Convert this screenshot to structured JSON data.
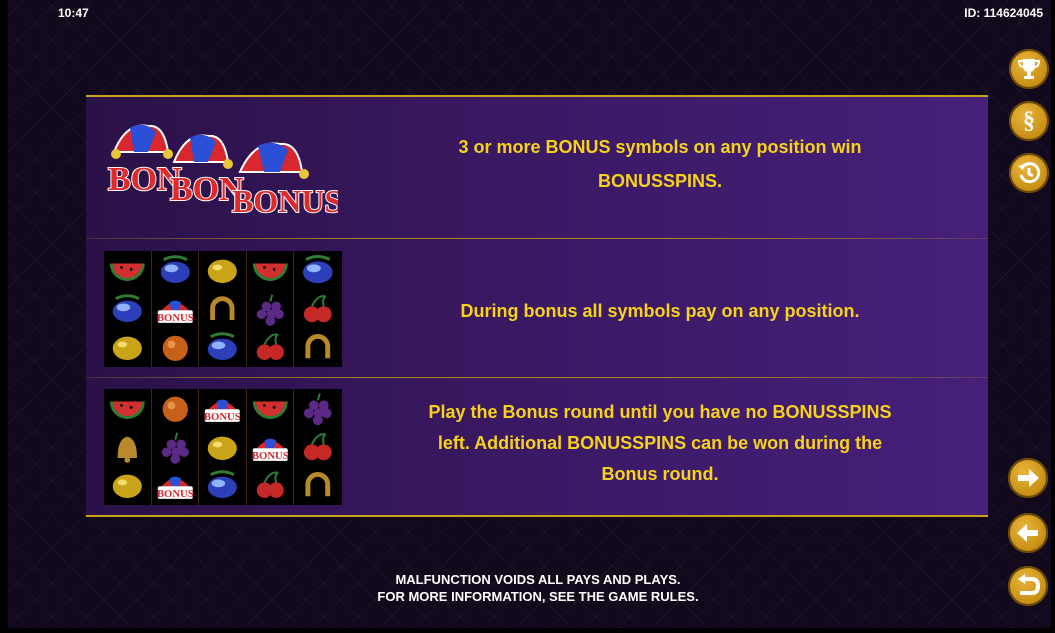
{
  "status": {
    "time": "10:47",
    "id_label": "ID: 114624045"
  },
  "rows": [
    {
      "text_lines": [
        "3 or more BONUS symbols on any position win",
        "BONUSSPINS."
      ]
    },
    {
      "text_lines": [
        "During bonus all symbols pay on any position."
      ]
    },
    {
      "text_lines": [
        "Play the Bonus round until you have no BONUSSPINS",
        "left. Additional BONUSSPINS can be won during the",
        "Bonus round."
      ]
    }
  ],
  "logo": {
    "words": [
      "BON",
      "BON",
      "BONUS"
    ]
  },
  "grid_symbol_label": "BONUS",
  "grid2": [
    "watermelon",
    "plum",
    "lemon",
    "watermelon",
    "plum",
    "plum",
    "bonus",
    "horseshoe",
    "grapes",
    "cherry",
    "lemon",
    "orange",
    "plum",
    "cherry",
    "horseshoe"
  ],
  "grid3": [
    "watermelon",
    "orange",
    "bonus",
    "watermelon",
    "grapes",
    "bell",
    "grapes",
    "lemon",
    "bonus",
    "cherry",
    "lemon",
    "bonus",
    "plum",
    "cherry",
    "horseshoe"
  ],
  "side_buttons": {
    "right_top": [
      "trophy-icon",
      "section-sign-icon",
      "history-icon"
    ],
    "right_bottom": [
      "arrow-right-icon",
      "arrow-left-icon",
      "return-icon"
    ]
  },
  "section_glyph": "§",
  "footer": {
    "line1": "MALFUNCTION VOIDS ALL PAYS AND PLAYS.",
    "line2": "FOR MORE INFORMATION, SEE THE GAME RULES."
  },
  "colors": {
    "accent_text": "#f6d21a",
    "gold_line": "#c9a21b",
    "panel": "#3a1862",
    "button_gold": "#c48d12"
  }
}
